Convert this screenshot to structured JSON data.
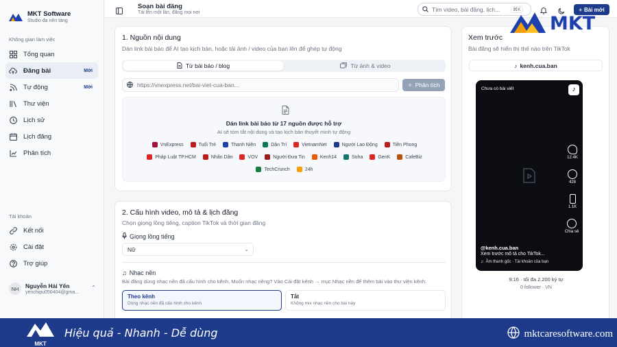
{
  "brand": {
    "name": "MKT Software",
    "tagline": "Studio đa nền tảng"
  },
  "sidebar": {
    "workspace_label": "Không gian làm việc",
    "items": [
      {
        "label": "Tổng quan",
        "icon": "grid-icon"
      },
      {
        "label": "Đăng bài",
        "icon": "cloud-upload-icon",
        "badge": "Mới",
        "active": true
      },
      {
        "label": "Tự động",
        "icon": "rss-icon",
        "badge": "Mới"
      },
      {
        "label": "Thư viện",
        "icon": "library-icon"
      },
      {
        "label": "Lịch sử",
        "icon": "clock-icon"
      },
      {
        "label": "Lịch đăng",
        "icon": "calendar-icon"
      },
      {
        "label": "Phân tích",
        "icon": "chart-icon"
      }
    ],
    "account_label": "Tài khoản",
    "account_items": [
      {
        "label": "Kết nối",
        "icon": "link-icon"
      },
      {
        "label": "Cài đặt",
        "icon": "gear-icon"
      },
      {
        "label": "Trợ giúp",
        "icon": "help-icon"
      }
    ],
    "user": {
      "initials": "NH",
      "name": "Nguyễn Hải Yến",
      "email": "yenchipu050404@gma..."
    }
  },
  "header": {
    "title": "Soạn bài đăng",
    "subtitle": "Tải lên một lần, đăng mọi nơi",
    "search_placeholder": "Tìm video, bài đăng, lịch...",
    "shortcut": "⌘K",
    "new_post": "Bài mới"
  },
  "source": {
    "title": "1. Nguồn nội dung",
    "desc": "Dán link bài báo để AI tạo kịch bản, hoặc tải ảnh / video của bạn lên để ghép tự động",
    "tab_blog": "Từ bài báo / blog",
    "tab_media": "Từ ảnh & video",
    "url_value": "https://vnexpress.net/bai-viet-cua-ban...",
    "analyze": "Phân tích",
    "drop_title": "Dán link bài báo từ 17 nguồn được hỗ trợ",
    "drop_sub": "AI sẽ tóm tắt nội dung và tạo kịch bản thuyết minh tự động",
    "sources": [
      {
        "name": "VnExpress",
        "color": "#9f1239"
      },
      {
        "name": "Tuổi Trẻ",
        "color": "#b91c1c"
      },
      {
        "name": "Thanh Niên",
        "color": "#1e40af"
      },
      {
        "name": "Dân Trí",
        "color": "#047857"
      },
      {
        "name": "VietnamNet",
        "color": "#dc2626"
      },
      {
        "name": "Người Lao Động",
        "color": "#1e3a8a"
      },
      {
        "name": "Tiền Phong",
        "color": "#b91c1c"
      },
      {
        "name": "Pháp Luật TP.HCM",
        "color": "#dc2626"
      },
      {
        "name": "Nhân Dân",
        "color": "#b91c1c"
      },
      {
        "name": "VOV",
        "color": "#dc2626"
      },
      {
        "name": "Người Đưa Tin",
        "color": "#991b1b"
      },
      {
        "name": "Kenh14",
        "color": "#ea580c"
      },
      {
        "name": "Soha",
        "color": "#0f766e"
      },
      {
        "name": "GenK",
        "color": "#dc2626"
      },
      {
        "name": "CafeBiz",
        "color": "#b45309"
      },
      {
        "name": "TechCrunch",
        "color": "#15803d"
      },
      {
        "name": "24h",
        "color": "#f59e0b"
      }
    ]
  },
  "config": {
    "title": "2. Cấu hình video, mô tả & lịch đăng",
    "desc": "Chọn giọng lồng tiếng, caption TikTok và thời gian đăng",
    "voice_label": "Giọng lồng tiếng",
    "voice_value": "Nữ",
    "music_label": "Nhạc nền",
    "music_desc": "Bài đăng dùng nhạc nền đã cấu hình cho kênh. Muốn nhạc riêng? Vào Cài đặt kênh → mục Nhạc nền để thêm bài vào thư viện kênh.",
    "opt_channel": "Theo kênh",
    "opt_channel_sub": "Dùng nhạc nền đã cấu hình cho kênh",
    "opt_off": "Tắt",
    "opt_off_sub": "Không mix nhạc nền cho bài này"
  },
  "preview": {
    "title": "Xem trước",
    "desc": "Bài đăng sẽ hiển thị thế nào trên TikTok",
    "account": "kenh.cua.ban",
    "status": "Chưa có bài viết",
    "likes": "12.4K",
    "comments": "428",
    "saves": "1.1K",
    "share": "Chia sẻ",
    "handle": "@kenh.cua.ban",
    "caption": "Xem trước mô tả cho TikTok...",
    "sound": "Âm thanh gốc · Tài khoản của bạn",
    "ratio": "9:16 · tối đa 2.200 ký tự",
    "meta": "0 follower · VN"
  },
  "watermark": {
    "text": "MKT"
  },
  "banner": {
    "slogan": "Hiệu quả - Nhanh - Dễ dùng",
    "site": "mktcaresoftware.com",
    "logo_text": "MKT"
  }
}
